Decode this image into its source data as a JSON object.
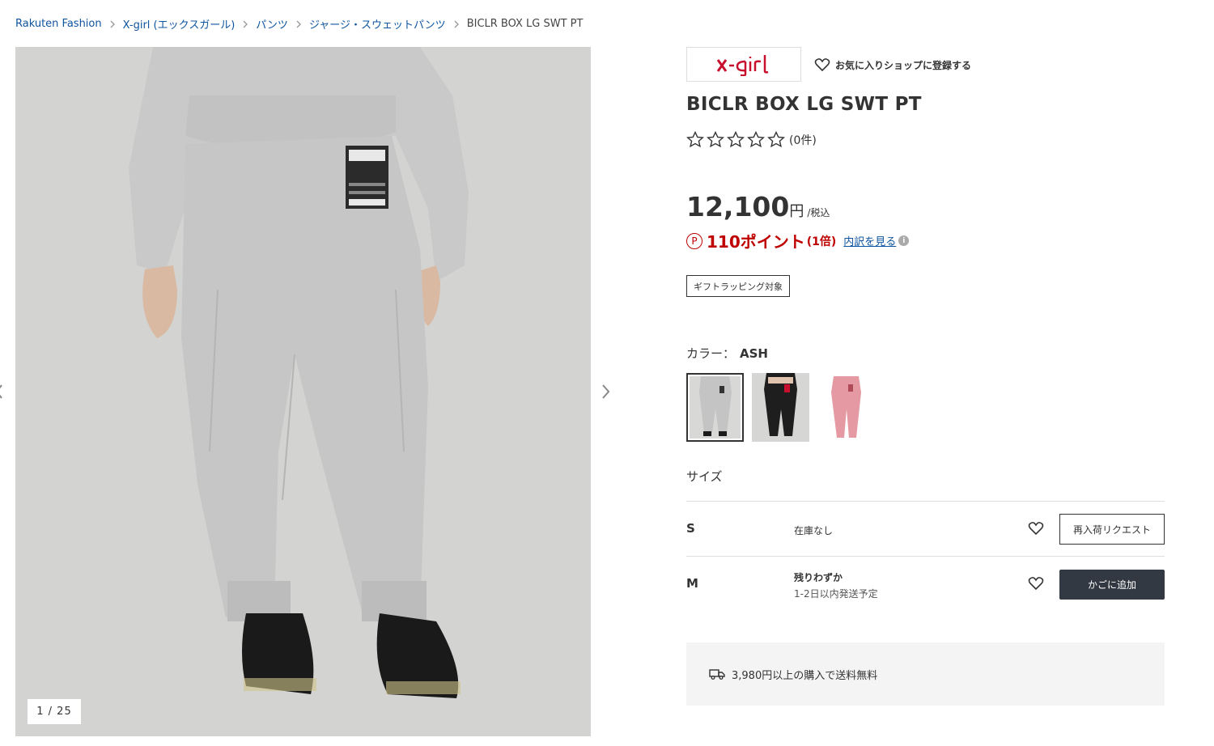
{
  "breadcrumb": [
    {
      "label": "Rakuten Fashion"
    },
    {
      "label": "X-girl (エックスガール)"
    },
    {
      "label": "パンツ"
    },
    {
      "label": "ジャージ・スウェットパンツ"
    },
    {
      "label": "BICLR BOX LG SWT PT"
    }
  ],
  "gallery": {
    "counter": "1 / 25"
  },
  "shop": {
    "logo_text": "x-girl",
    "favorite_label": "お気に入りショップに登録する",
    "brand_color": "#c8102e"
  },
  "product": {
    "title": "BICLR BOX LG SWT PT",
    "review_count": "(0件)",
    "rating_stars": 0,
    "price": "12,100",
    "currency": "円",
    "tax_note": "/税込",
    "points": "110ポイント",
    "points_multiplier": "(1倍)",
    "points_breakdown_link": "内訳を見る",
    "gift_badge": "ギフトラッピング対象"
  },
  "color": {
    "label": "カラー：",
    "selected": "ASH",
    "options": [
      "ASH",
      "BLACK",
      "PINK"
    ]
  },
  "sizes": {
    "label": "サイズ",
    "rows": [
      {
        "size": "S",
        "stock": "在庫なし",
        "delivery": "",
        "button": "再入荷リクエスト"
      },
      {
        "size": "M",
        "stock": "残りわずか",
        "delivery": "1-2日以内発送予定",
        "button": "かごに追加"
      }
    ]
  },
  "shipping": {
    "text": "3,980円以上の購入で送料無料"
  },
  "colors": {
    "link": "#0e55a0",
    "point_red": "#bf0000",
    "dark_button": "#333942"
  }
}
